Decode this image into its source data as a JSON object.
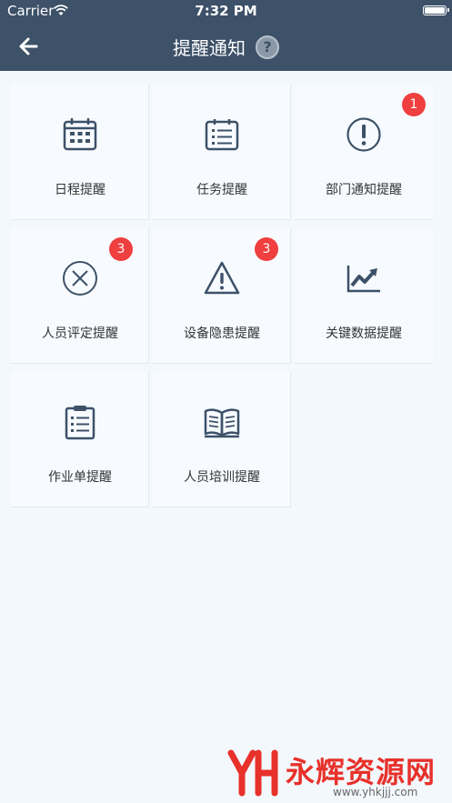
{
  "status_bar": {
    "carrier": "Carrier",
    "time": "7:32 PM"
  },
  "nav": {
    "title": "提醒通知",
    "help_label": "?",
    "back_icon": "arrow-left-icon"
  },
  "items": [
    {
      "label": "日程提醒",
      "icon": "calendar-icon",
      "badge": ""
    },
    {
      "label": "任务提醒",
      "icon": "task-list-icon",
      "badge": ""
    },
    {
      "label": "部门通知提醒",
      "icon": "exclamation-circle-icon",
      "badge": "1"
    },
    {
      "label": "人员评定提醒",
      "icon": "x-circle-icon",
      "badge": "3"
    },
    {
      "label": "设备隐患提醒",
      "icon": "warning-triangle-icon",
      "badge": "3"
    },
    {
      "label": "关键数据提醒",
      "icon": "line-chart-icon",
      "badge": ""
    },
    {
      "label": "作业单提醒",
      "icon": "clipboard-icon",
      "badge": ""
    },
    {
      "label": "人员培训提醒",
      "icon": "open-book-icon",
      "badge": ""
    }
  ],
  "watermark": {
    "title": "永辉资源网",
    "url": "www.yhkjjj.com"
  },
  "colors": {
    "header": "#3d5168",
    "badge": "#ef3f3f",
    "icon": "#3d5168",
    "background": "#f3f8fd"
  }
}
